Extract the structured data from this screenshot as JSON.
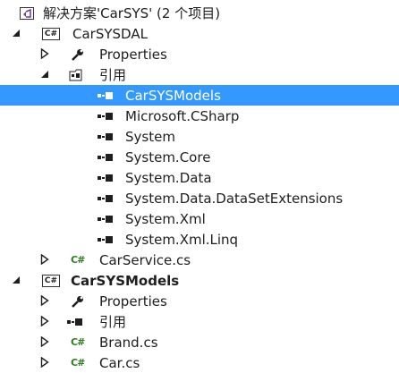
{
  "tree": {
    "solution": {
      "label": "解决方案'CarSYS' (2 个项目)"
    },
    "project1": {
      "label": "CarSYSDAL",
      "icon": "csharp-project-icon",
      "properties": {
        "label": "Properties",
        "icon": "wrench-icon"
      },
      "references": {
        "label": "引用",
        "icon": "references-folder-icon",
        "items": [
          {
            "label": "CarSYSModels",
            "selected": true
          },
          {
            "label": "Microsoft.CSharp"
          },
          {
            "label": "System"
          },
          {
            "label": "System.Core"
          },
          {
            "label": "System.Data"
          },
          {
            "label": "System.Data.DataSetExtensions"
          },
          {
            "label": "System.Xml"
          },
          {
            "label": "System.Xml.Linq"
          }
        ]
      },
      "files": [
        {
          "label": "CarService.cs",
          "icon": "csharp-file-icon"
        }
      ]
    },
    "project2": {
      "label": "CarSYSModels",
      "icon": "csharp-project-icon",
      "properties": {
        "label": "Properties",
        "icon": "wrench-icon"
      },
      "references": {
        "label": "引用",
        "icon": "reference-icon"
      },
      "files": [
        {
          "label": "Brand.cs",
          "icon": "csharp-file-icon"
        },
        {
          "label": "Car.cs",
          "icon": "csharp-file-icon"
        }
      ]
    },
    "project_icon_text": "C#",
    "file_icon_text": "C#",
    "selection_color": "#3399ff"
  }
}
